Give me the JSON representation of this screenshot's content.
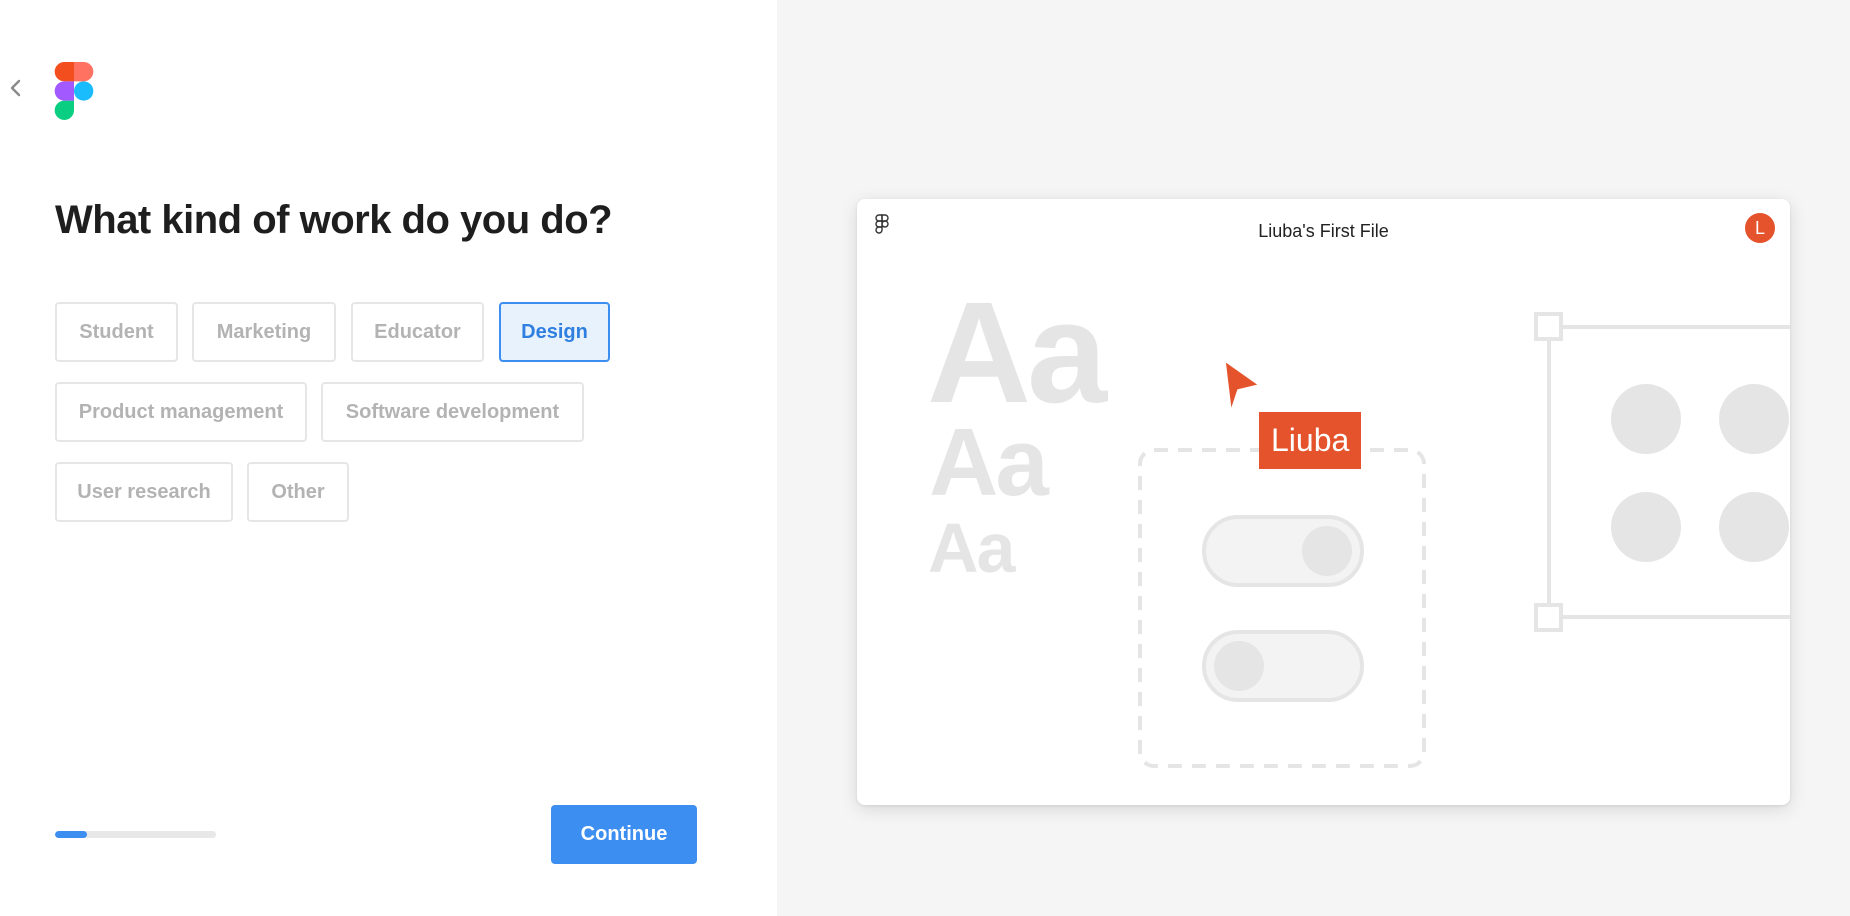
{
  "title": "What kind of work do you do?",
  "options": [
    {
      "label": "Student",
      "selected": false
    },
    {
      "label": "Marketing",
      "selected": false
    },
    {
      "label": "Educator",
      "selected": false
    },
    {
      "label": "Design",
      "selected": true
    },
    {
      "label": "Product management",
      "selected": false
    },
    {
      "label": "Software development",
      "selected": false
    },
    {
      "label": "User research",
      "selected": false
    },
    {
      "label": "Other",
      "selected": false
    }
  ],
  "progress": 0.2,
  "continue_label": "Continue",
  "preview": {
    "file_title": "Liuba's First File",
    "avatar_letter": "L",
    "type_samples": [
      "Aa",
      "Aa",
      "Aa"
    ],
    "cursor_name": "Liuba"
  },
  "icons": {
    "back": "chevron-left-icon",
    "logo": "figma-logo",
    "menu": "figma-menu-icon",
    "cursor": "cursor-arrow-icon"
  },
  "colors": {
    "accent": "#3d8ef1",
    "selected_bg": "#e8f2fd",
    "cursor": "#e4532b",
    "logo_red": "#f24e1e",
    "logo_orange": "#ff7262",
    "logo_purple": "#a259ff",
    "logo_blue": "#1abcfe",
    "logo_green": "#0acf83"
  }
}
